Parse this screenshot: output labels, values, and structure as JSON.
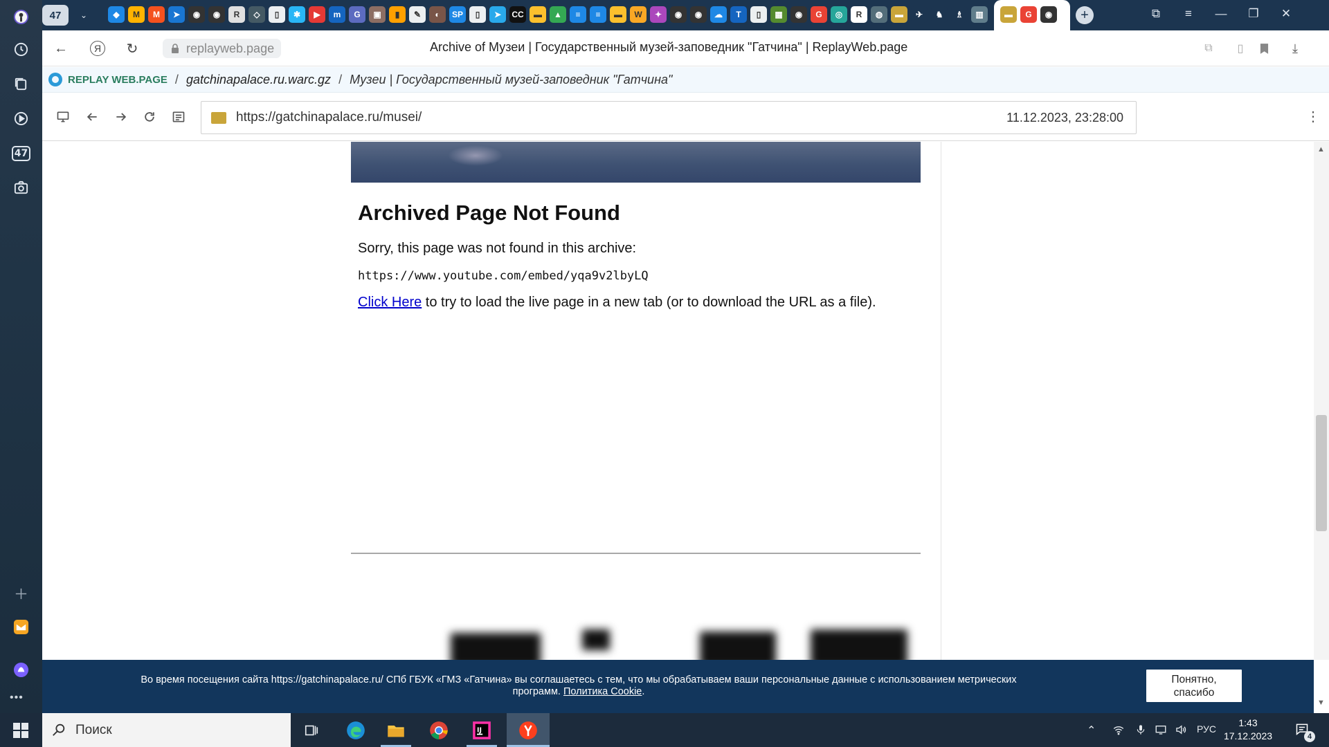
{
  "sidebar": {
    "tab_count_badge": "47",
    "icons": [
      "history-icon",
      "collections-icon",
      "play-icon",
      "tab-count-icon",
      "screenshot-icon",
      "add-icon",
      "mail-app-icon",
      "alice-icon",
      "more-icon"
    ]
  },
  "tabstrip": {
    "tab_count": "47",
    "dropdown": "⌄",
    "favicons": [
      {
        "glyph": "◆",
        "bg": "#1e88e5"
      },
      {
        "glyph": "M",
        "bg": "#ffb300"
      },
      {
        "glyph": "M",
        "bg": "#f4511e"
      },
      {
        "glyph": "➤",
        "bg": "#1976d2"
      },
      {
        "glyph": "◉",
        "bg": "#333333"
      },
      {
        "glyph": "◉",
        "bg": "#333333"
      },
      {
        "glyph": "R",
        "bg": "#e0e0e0"
      },
      {
        "glyph": "◇",
        "bg": "#455a64"
      },
      {
        "glyph": "▯",
        "bg": "#eceff1"
      },
      {
        "glyph": "✱",
        "bg": "#29b6f6"
      },
      {
        "glyph": "▶",
        "bg": "#e53935"
      },
      {
        "glyph": "m",
        "bg": "#1565c0"
      },
      {
        "glyph": "G",
        "bg": "#5c6bc0"
      },
      {
        "glyph": "▣",
        "bg": "#8d6e63"
      },
      {
        "glyph": "▮",
        "bg": "#ffa000"
      },
      {
        "glyph": "✎",
        "bg": "#eceff1"
      },
      {
        "glyph": "◐",
        "bg": "#795548"
      },
      {
        "glyph": "SP",
        "bg": "#1e88e5"
      },
      {
        "glyph": "▯",
        "bg": "#eceff1"
      },
      {
        "glyph": "➤",
        "bg": "#29a9eb"
      },
      {
        "glyph": "CC",
        "bg": "#111111"
      },
      {
        "glyph": "▬",
        "bg": "#fbc02d"
      },
      {
        "glyph": "▲",
        "bg": "#34a853"
      },
      {
        "glyph": "≡",
        "bg": "#1e88e5"
      },
      {
        "glyph": "≡",
        "bg": "#1e88e5"
      },
      {
        "glyph": "▬",
        "bg": "#fbc02d"
      },
      {
        "glyph": "W",
        "bg": "#f9a825"
      },
      {
        "glyph": "✦",
        "bg": "#ab47bc"
      },
      {
        "glyph": "◉",
        "bg": "#333333"
      },
      {
        "glyph": "◉",
        "bg": "#333333"
      },
      {
        "glyph": "☁",
        "bg": "#1e88e5"
      },
      {
        "glyph": "T",
        "bg": "#1565c0"
      },
      {
        "glyph": "▯",
        "bg": "#eceff1"
      },
      {
        "glyph": "▦",
        "bg": "#558b2f"
      },
      {
        "glyph": "◉",
        "bg": "#333333"
      },
      {
        "glyph": "G",
        "bg": "#ea4335"
      },
      {
        "glyph": "◎",
        "bg": "#26a69a"
      },
      {
        "glyph": "R",
        "bg": "#ffffff"
      },
      {
        "glyph": "◍",
        "bg": "#546e7a"
      },
      {
        "glyph": "▬",
        "bg": "#c9a53a"
      },
      {
        "glyph": "✈",
        "bg": "#1c3550"
      },
      {
        "glyph": "♞",
        "bg": "#1c3550"
      },
      {
        "glyph": "♗",
        "bg": "#1c3550"
      },
      {
        "glyph": "▥",
        "bg": "#607d8b"
      }
    ],
    "active_tab_icons": [
      {
        "glyph": "▬",
        "bg": "#c9a53a"
      },
      {
        "glyph": "G",
        "bg": "#ea4335"
      },
      {
        "glyph": "◉",
        "bg": "#333333"
      }
    ],
    "new_tab": "+",
    "window_controls": {
      "bookmarks": "⧉",
      "menu": "≡",
      "minimize": "—",
      "restore": "❐",
      "close": "✕"
    }
  },
  "toolbar": {
    "back": "←",
    "yandex": "Я",
    "reload": "↻",
    "host": "replayweb.page",
    "title": "Archive of Музеи | Государственный музей-заповедник \"Гатчина\" | ReplayWeb.page",
    "right_icons": [
      "⧉",
      "▯",
      "🔖",
      "⤓"
    ]
  },
  "rwp": {
    "app_name": "REPLAY WEB.PAGE",
    "separator": "/",
    "archive_file": "gatchinapalace.ru.warc.gz",
    "page_name": "Музеи | Государственный музей-заповедник \"Гатчина\""
  },
  "replay_bar": {
    "url": "https://gatchinapalace.ru/musei/",
    "timestamp": "11.12.2023, 23:28:00",
    "kebab": "⋮"
  },
  "archived": {
    "heading": "Archived Page Not Found",
    "sorry": "Sorry, this page was not found in this archive:",
    "missing_url": "https://www.youtube.com/embed/yqa9v2lbyLQ",
    "click_here": "Click Here",
    "click_rest": " to try to load the live page in a new tab (or to download the URL as a file)."
  },
  "cookie": {
    "text_before": "Во время посещения сайта https://gatchinapalace.ru/ СПб ГБУК «ГМЗ «Гатчина» вы соглашаетесь с тем, что мы обрабатываем ваши персональные данные с использованием метрических программ. ",
    "policy_link": "Политика Cookie",
    "text_after": ".",
    "accept_line1": "Понятно,",
    "accept_line2": "спасибо"
  },
  "taskbar": {
    "search_placeholder": "Поиск",
    "lang": "РУС",
    "time": "1:43",
    "date": "17.12.2023",
    "notifications": "4"
  }
}
